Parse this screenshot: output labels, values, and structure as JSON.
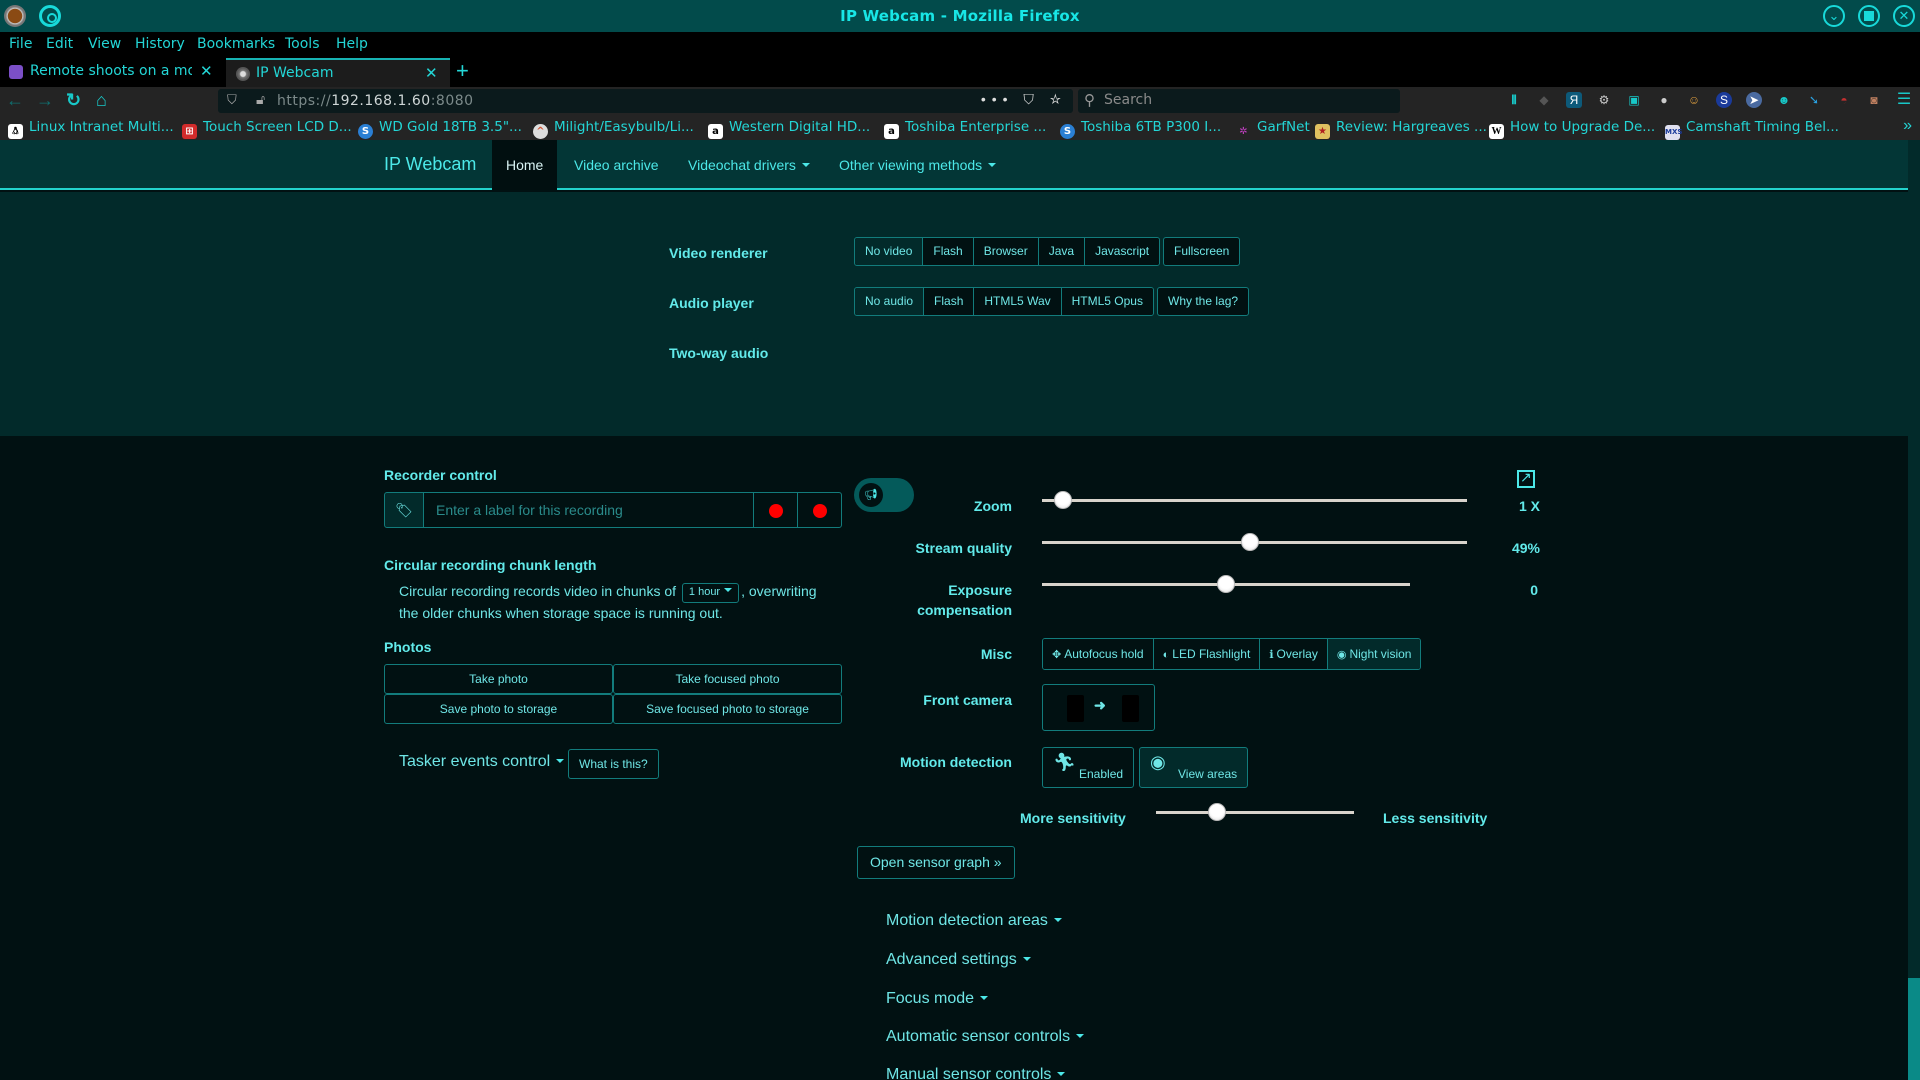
{
  "window": {
    "title": "IP Webcam - Mozilla Firefox",
    "controls": [
      "minimize",
      "maximize",
      "close"
    ]
  },
  "menubar": [
    "File",
    "Edit",
    "View",
    "History",
    "Bookmarks",
    "Tools",
    "Help"
  ],
  "tabs": [
    {
      "label": "Remote shoots on a mobile",
      "active": false
    },
    {
      "label": "IP Webcam",
      "active": true
    }
  ],
  "toolbar": {
    "url_scheme": "https://",
    "url_host": "192.168.1.60",
    "url_port": ":8080",
    "search_placeholder": "Search",
    "page_actions": "••• ⛉ ☆"
  },
  "bookmarks": [
    {
      "label": "Linux Intranet Multi...",
      "icon": "tux-icon",
      "color": "#ffffff"
    },
    {
      "label": "Touch Screen LCD D...",
      "icon": "cart-icon",
      "color": "#d22b2b"
    },
    {
      "label": "WD Gold 18TB 3.5\"...",
      "icon": "s-icon",
      "color": "#2a7fd4"
    },
    {
      "label": "Milight/Easybulb/Li...",
      "icon": "milight-icon",
      "color": "#dddddd"
    },
    {
      "label": "Western Digital HD...",
      "icon": "amazon-icon",
      "color": "#ffffff"
    },
    {
      "label": "Toshiba Enterprise ...",
      "icon": "amazon-icon",
      "color": "#ffffff"
    },
    {
      "label": "Toshiba 6TB P300 I...",
      "icon": "s-icon",
      "color": "#2a7fd4"
    },
    {
      "label": "GarfNet",
      "icon": "butterfly-icon",
      "color": "#c040c0"
    },
    {
      "label": "Review: Hargreaves ...",
      "icon": "review-icon",
      "color": "#e0c060"
    },
    {
      "label": "How to Upgrade De...",
      "icon": "wikipedia-icon",
      "color": "#ffffff"
    },
    {
      "label": "Camshaft Timing Bel...",
      "icon": "mxs-icon",
      "color": "#e0e0f0"
    }
  ],
  "site": {
    "brand": "IP Webcam",
    "nav": [
      {
        "label": "Home",
        "active": true,
        "dropdown": false
      },
      {
        "label": "Video archive",
        "active": false,
        "dropdown": false
      },
      {
        "label": "Videochat drivers",
        "active": false,
        "dropdown": true
      },
      {
        "label": "Other viewing methods",
        "active": false,
        "dropdown": true
      }
    ]
  },
  "video_renderer": {
    "label": "Video renderer",
    "options": [
      "No video",
      "Flash",
      "Browser",
      "Java",
      "Javascript"
    ],
    "selected": "No video",
    "extra": "Fullscreen"
  },
  "audio_player": {
    "label": "Audio player",
    "options": [
      "No audio",
      "Flash",
      "HTML5 Wav",
      "HTML5 Opus"
    ],
    "selected": "No audio",
    "extra": "Why the lag?"
  },
  "two_way_audio": {
    "label": "Two-way audio",
    "enabled": false
  },
  "recorder": {
    "title": "Recorder control",
    "placeholder": "Enter a label for this recording"
  },
  "chunk": {
    "title": "Circular recording chunk length",
    "text_before": "Circular recording records video in chunks of",
    "value": "1 hour",
    "text_after": ", overwriting",
    "text_line2": "the older chunks when storage space is running out."
  },
  "photos": {
    "title": "Photos",
    "buttons": [
      "Take photo",
      "Take focused photo",
      "Save photo to storage",
      "Save focused photo to storage"
    ]
  },
  "tasker": {
    "title": "Tasker events control",
    "help": "What is this?"
  },
  "sliders": {
    "zoom": {
      "label": "Zoom",
      "value_text": "1 X",
      "fraction": 0.05
    },
    "stream_quality": {
      "label": "Stream quality",
      "value_text": "49%",
      "fraction": 0.49
    },
    "exposure": {
      "label": "Exposure compensation",
      "label_line1": "Exposure",
      "label_line2": "compensation",
      "value_text": "0",
      "fraction": 0.5
    }
  },
  "misc": {
    "label": "Misc",
    "options": [
      {
        "label": "Autofocus hold",
        "icon": "crosshair-icon",
        "glyph": "✥",
        "selected": false
      },
      {
        "label": "LED Flashlight",
        "icon": "half-circle-icon",
        "glyph": "◐",
        "selected": false
      },
      {
        "label": "Overlay",
        "icon": "info-icon",
        "glyph": "ℹ",
        "selected": false
      },
      {
        "label": "Night vision",
        "icon": "eye-icon",
        "glyph": "◉",
        "selected": true
      }
    ]
  },
  "front_camera": {
    "label": "Front camera",
    "arrow": "➜"
  },
  "motion_detection": {
    "label": "Motion detection",
    "enabled_label": "Enabled",
    "view_areas_label": "View areas",
    "more_sensitivity": "More sensitivity",
    "less_sensitivity": "Less sensitivity",
    "sensitivity_fraction": 0.31
  },
  "sensor_graph": "Open sensor graph »",
  "collapsibles": [
    "Motion detection areas",
    "Advanced settings",
    "Focus mode",
    "Automatic sensor controls",
    "Manual sensor controls"
  ]
}
